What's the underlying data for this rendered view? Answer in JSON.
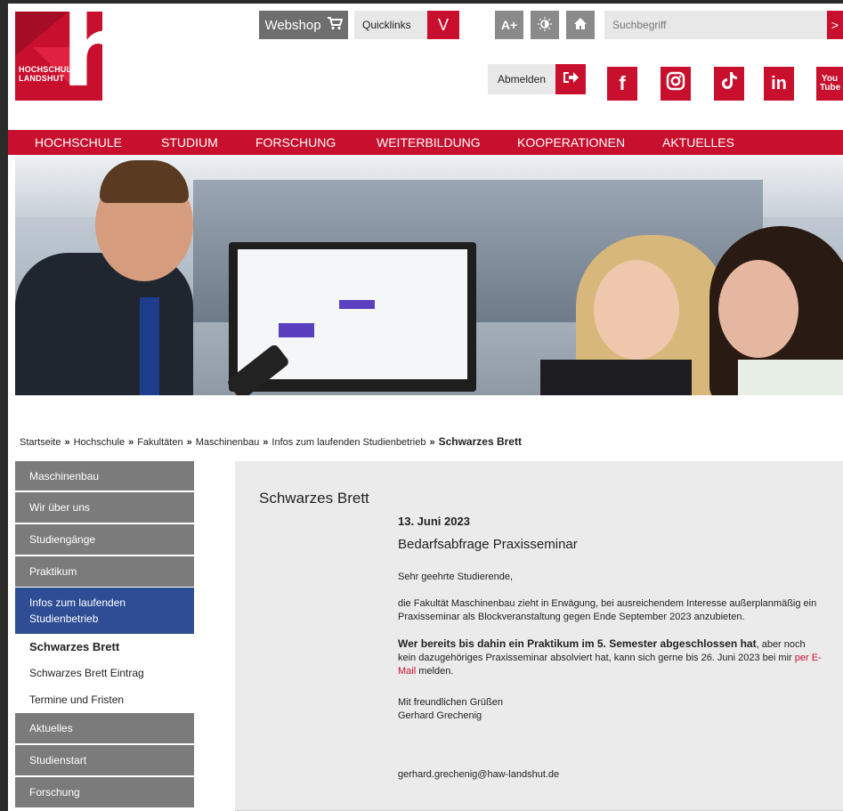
{
  "logo": {
    "line1": "HOCHSCHULE",
    "line2": "LANDSHUT"
  },
  "topbar": {
    "webshop_label": "Webshop",
    "quicklinks_label": "Quicklinks",
    "quicklinks_toggle": "V",
    "font_size_label": "A+",
    "search_placeholder": "Suchbegriff",
    "search_go": ">",
    "logout_label": "Abmelden"
  },
  "social": [
    {
      "name": "facebook",
      "glyph": "f"
    },
    {
      "name": "instagram",
      "glyph": "◎"
    },
    {
      "name": "tiktok",
      "glyph": "♪"
    },
    {
      "name": "linkedin",
      "glyph": "in"
    },
    {
      "name": "youtube",
      "glyph": "You Tube"
    }
  ],
  "mainnav": [
    "HOCHSCHULE",
    "STUDIUM",
    "FORSCHUNG",
    "WEITERBILDUNG",
    "KOOPERATIONEN",
    "AKTUELLES"
  ],
  "breadcrumb": {
    "items": [
      "Startseite",
      "Hochschule",
      "Fakultäten",
      "Maschinenbau",
      "Infos zum laufenden Studienbetrieb"
    ],
    "separator": "»",
    "current": "Schwarzes Brett"
  },
  "sidebar": {
    "items": [
      {
        "label": "Maschinenbau"
      },
      {
        "label": "Wir über uns"
      },
      {
        "label": "Studiengänge"
      },
      {
        "label": "Praktikum"
      },
      {
        "label": "Infos zum laufenden Studienbetrieb"
      },
      {
        "label": "Schwarzes Brett"
      },
      {
        "label": "Schwarzes Brett Eintrag"
      },
      {
        "label": "Termine und Fristen"
      },
      {
        "label": "Aktuelles"
      },
      {
        "label": "Studienstart"
      },
      {
        "label": "Forschung"
      }
    ]
  },
  "content": {
    "title": "Schwarzes Brett",
    "date": "13. Juni 2023",
    "heading": "Bedarfsabfrage Praxisseminar",
    "greeting": "Sehr geehrte Studierende,",
    "para1": "die Fakultät Maschinenbau zieht in Erwägung, bei ausreichendem Interesse außerplanmäßig ein Praxisseminar als Blockveranstaltung gegen Ende September 2023 anzubieten.",
    "para2_bold": "Wer bereits bis dahin ein Praktikum im 5. Semester abgeschlossen hat",
    "para2_rest": ", aber noch kein dazugehöriges Praxisseminar absolviert hat, kann sich gerne bis 26. Juni 2023 bei mir ",
    "para2_link": "per E-Mail",
    "para2_end": " melden.",
    "closing": "Mit freundlichen Grüßen",
    "signature": "Gerhard Grechenig",
    "email": "gerhard.grechenig@haw-landshut.de"
  },
  "colors": {
    "brand_red": "#c8102e",
    "nav_blue": "#2e4d94",
    "side_grey": "#7b7b7b"
  }
}
